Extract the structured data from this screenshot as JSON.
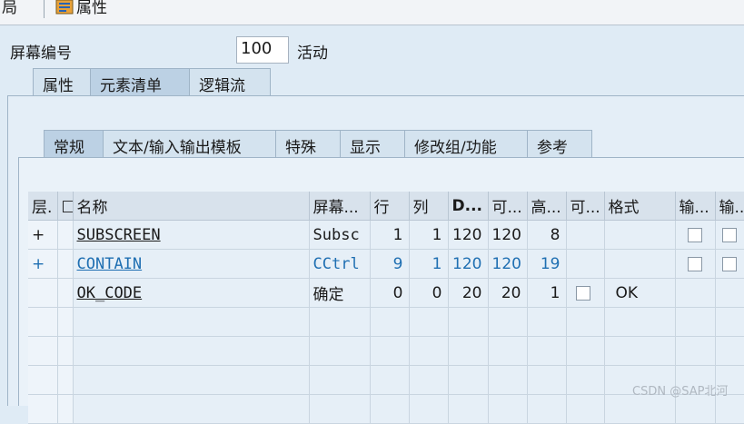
{
  "toolbar": {
    "left_text": "局",
    "properties_label": "属性"
  },
  "screen": {
    "label": "屏幕编号",
    "number": "100",
    "status": "活动"
  },
  "outer_tabs": [
    "属性",
    "元素清单",
    "逻辑流"
  ],
  "inner_tabs": [
    "常规",
    "文本/输入输出模板",
    "特殊",
    "显示",
    "修改组/功能",
    "参考"
  ],
  "table": {
    "columns": [
      "层.",
      "□",
      "名称",
      "屏幕...",
      "行",
      "列",
      "D...",
      "可...",
      "高...",
      "可...",
      "格式",
      "输...",
      "输..."
    ],
    "rows": [
      {
        "level": "+",
        "name": "SUBSCREEN",
        "type": "Subsc",
        "row": "1",
        "col": "1",
        "d": "120",
        "vis": "120",
        "height": "8",
        "format": ""
      },
      {
        "level": "+",
        "name": "CONTAIN",
        "type": "CCtrl",
        "row": "9",
        "col": "1",
        "d": "120",
        "vis": "120",
        "height": "19",
        "format": ""
      },
      {
        "level": "",
        "name": "OK_CODE",
        "type": "确定",
        "row": "0",
        "col": "0",
        "d": "20",
        "vis": "20",
        "height": "1",
        "format": "OK"
      }
    ]
  },
  "watermark": "CSDN @SAP北河"
}
